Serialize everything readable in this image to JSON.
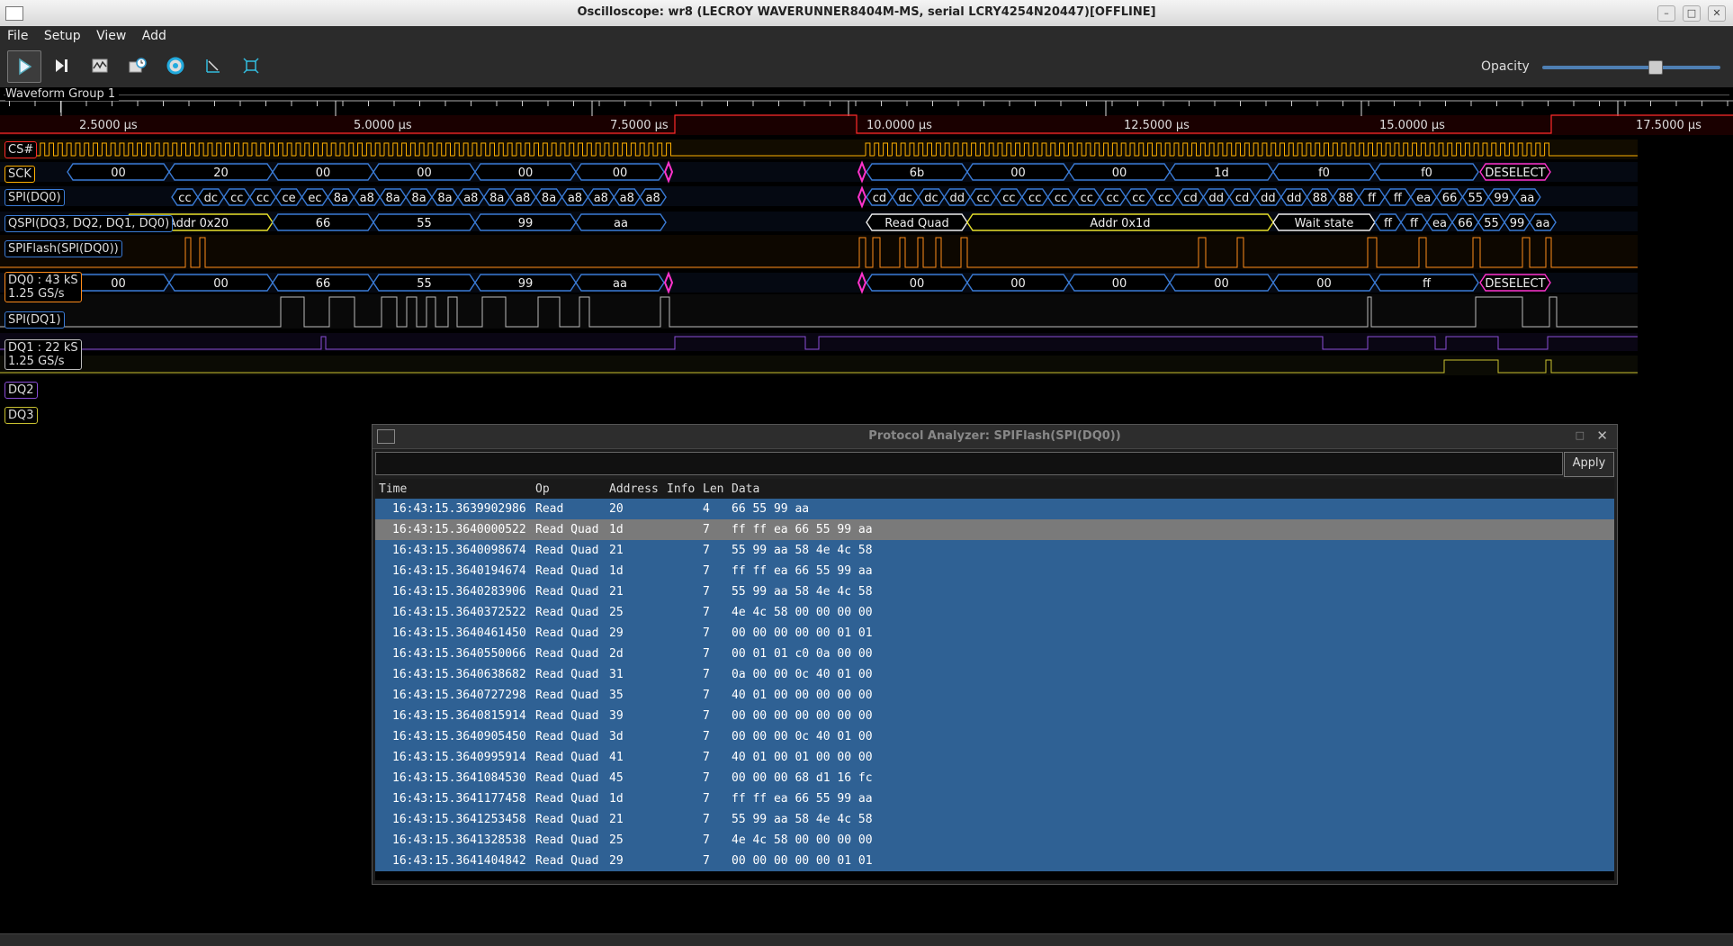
{
  "window": {
    "title": "Oscilloscope: wr8 (LECROY WAVERUNNER8404M-MS, serial LCRY4254N20447)[OFFLINE]"
  },
  "menu": [
    "File",
    "Setup",
    "View",
    "Add"
  ],
  "toolbar": {
    "icons": [
      "play-icon",
      "single-step-icon",
      "waveform-history-icon",
      "timebase-icon",
      "trigger-settings-icon",
      "measurement-icon",
      "fullscreen-icon"
    ],
    "opacity_label": "Opacity",
    "opacity_value": 0.6
  },
  "waveform_group": {
    "label": "Waveform Group 1",
    "time_ticks": [
      "2.5000 µs",
      "5.0000 µs",
      "7.5000 µs",
      "10.0000 µs",
      "12.5000 µs",
      "15.0000 µs",
      "17.5000 µs"
    ]
  },
  "channels": {
    "cs": "CS#",
    "sck": "SCK",
    "spi_dq0": "SPI(DQ0)",
    "qspi": "QSPI(DQ3, DQ2, DQ1, DQ0)",
    "spiflash": "SPIFlash(SPI(DQ0))",
    "dq0": [
      "DQ0 : 43 kS",
      "1.25 GS/s"
    ],
    "spi_dq1": "SPI(DQ1)",
    "dq1": [
      "DQ1 : 22 kS",
      "1.25 GS/s"
    ],
    "dq2": "DQ2",
    "dq3": "DQ3"
  },
  "decodes": {
    "spi_dq0": [
      "00",
      "20",
      "00",
      "00",
      "00",
      "00",
      "6b",
      "00",
      "00",
      "1d",
      "f0",
      "f0",
      "DESELECT"
    ],
    "qspi_a": [
      "cc",
      "dc",
      "cc",
      "cc",
      "ce",
      "ec",
      "8a",
      "a8",
      "8a",
      "8a",
      "8a",
      "a8",
      "8a",
      "a8",
      "8a",
      "a8",
      "a8",
      "a8",
      "a8"
    ],
    "qspi_b": [
      "cd",
      "dc",
      "dc",
      "dd",
      "cc",
      "cc",
      "cc",
      "cc",
      "cc",
      "cc",
      "cc",
      "cc",
      "cd",
      "dd",
      "cd",
      "dd",
      "dd",
      "88",
      "88",
      "ff",
      "ff",
      "ea",
      "66",
      "55",
      "99",
      "aa"
    ],
    "spiflash": [
      "Addr 0x20",
      "66",
      "55",
      "99",
      "aa",
      "Read Quad",
      "Addr 0x1d",
      "Wait state",
      "ff",
      "ff",
      "ea",
      "66",
      "55",
      "99",
      "aa"
    ],
    "spi_dq1": [
      "00",
      "00",
      "66",
      "55",
      "99",
      "aa",
      "00",
      "00",
      "00",
      "00",
      "00",
      "ff",
      "DESELECT"
    ]
  },
  "protocol_analyzer": {
    "title": "Protocol Analyzer: SPIFlash(SPI(DQ0))",
    "filter_value": "",
    "apply_label": "Apply",
    "columns": [
      "Time",
      "Op",
      "Address",
      "Info",
      "Len",
      "Data"
    ],
    "selected_index": 1,
    "rows": [
      {
        "time": "16:43:15.3639902986",
        "op": "Read",
        "address": "20",
        "info": "",
        "len": "4",
        "data": "66 55 99 aa"
      },
      {
        "time": "16:43:15.3640000522",
        "op": "Read Quad",
        "address": "1d",
        "info": "",
        "len": "7",
        "data": "ff ff ea 66 55 99 aa"
      },
      {
        "time": "16:43:15.3640098674",
        "op": "Read Quad",
        "address": "21",
        "info": "",
        "len": "7",
        "data": "55 99 aa 58 4e 4c 58"
      },
      {
        "time": "16:43:15.3640194674",
        "op": "Read Quad",
        "address": "1d",
        "info": "",
        "len": "7",
        "data": "ff ff ea 66 55 99 aa"
      },
      {
        "time": "16:43:15.3640283906",
        "op": "Read Quad",
        "address": "21",
        "info": "",
        "len": "7",
        "data": "55 99 aa 58 4e 4c 58"
      },
      {
        "time": "16:43:15.3640372522",
        "op": "Read Quad",
        "address": "25",
        "info": "",
        "len": "7",
        "data": "4e 4c 58 00 00 00 00"
      },
      {
        "time": "16:43:15.3640461450",
        "op": "Read Quad",
        "address": "29",
        "info": "",
        "len": "7",
        "data": "00 00 00 00 00 01 01"
      },
      {
        "time": "16:43:15.3640550066",
        "op": "Read Quad",
        "address": "2d",
        "info": "",
        "len": "7",
        "data": "00 01 01 c0 0a 00 00"
      },
      {
        "time": "16:43:15.3640638682",
        "op": "Read Quad",
        "address": "31",
        "info": "",
        "len": "7",
        "data": "0a 00 00 0c 40 01 00"
      },
      {
        "time": "16:43:15.3640727298",
        "op": "Read Quad",
        "address": "35",
        "info": "",
        "len": "7",
        "data": "40 01 00 00 00 00 00"
      },
      {
        "time": "16:43:15.3640815914",
        "op": "Read Quad",
        "address": "39",
        "info": "",
        "len": "7",
        "data": "00 00 00 00 00 00 00"
      },
      {
        "time": "16:43:15.3640905450",
        "op": "Read Quad",
        "address": "3d",
        "info": "",
        "len": "7",
        "data": "00 00 00 0c 40 01 00"
      },
      {
        "time": "16:43:15.3640995914",
        "op": "Read Quad",
        "address": "41",
        "info": "",
        "len": "7",
        "data": "40 01 00 01 00 00 00"
      },
      {
        "time": "16:43:15.3641084530",
        "op": "Read Quad",
        "address": "45",
        "info": "",
        "len": "7",
        "data": "00 00 00 68 d1 16 fc"
      },
      {
        "time": "16:43:15.3641177458",
        "op": "Read Quad",
        "address": "1d",
        "info": "",
        "len": "7",
        "data": "ff ff ea 66 55 99 aa"
      },
      {
        "time": "16:43:15.3641253458",
        "op": "Read Quad",
        "address": "21",
        "info": "",
        "len": "7",
        "data": "55 99 aa 58 4e 4c 58"
      },
      {
        "time": "16:43:15.3641328538",
        "op": "Read Quad",
        "address": "25",
        "info": "",
        "len": "7",
        "data": "4e 4c 58 00 00 00 00"
      },
      {
        "time": "16:43:15.3641404842",
        "op": "Read Quad",
        "address": "29",
        "info": "",
        "len": "7",
        "data": "00 00 00 00 00 01 01"
      }
    ]
  },
  "colors": {
    "cs": "#ff2a2a",
    "sck": "#ffb000",
    "dq0": "#ff8c1a",
    "dq1": "#bbbbbb",
    "dq2": "#8a4dd6",
    "dq3": "#c8c030",
    "decode_blue": "#3a7bd5",
    "decode_yellow": "#e8e02a",
    "decode_magenta": "#ff33cc",
    "row_blue": "#2f6194",
    "row_selected": "#7a7a7a"
  }
}
